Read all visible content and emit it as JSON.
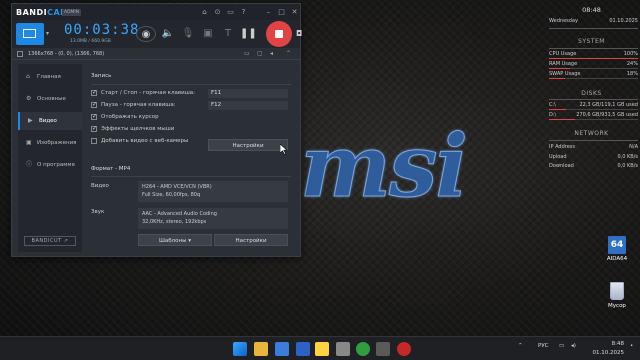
{
  "bandicam": {
    "logo_a": "BANDI",
    "logo_b": "CAM",
    "badge": "ADMIN",
    "timer": "00:03:38",
    "size": "13.0MB / 660.9GB",
    "resolution": "1366x768 - (0, 0), (1366, 768)",
    "sidebar": [
      {
        "label": "Главная",
        "icon": "home-icon"
      },
      {
        "label": "Основные",
        "icon": "gear-icon"
      },
      {
        "label": "Видео",
        "icon": "video-icon"
      },
      {
        "label": "Изображения",
        "icon": "image-icon"
      },
      {
        "label": "О программе",
        "icon": "info-icon"
      }
    ],
    "bandicut": "BANDICUT ↗",
    "record": {
      "title": "Запись",
      "items": [
        {
          "label": "Старт / Стоп - горячая клавиша:",
          "checked": true,
          "hotkey": "F11"
        },
        {
          "label": "Пауза - горячая клавиша:",
          "checked": true,
          "hotkey": "F12"
        },
        {
          "label": "Отображать курсор",
          "checked": true
        },
        {
          "label": "Эффекты щелчков мыши",
          "checked": true
        },
        {
          "label": "Добавить видео с веб-камеры",
          "checked": false
        }
      ],
      "settings_button": "Настройки"
    },
    "format": {
      "title": "Формат - MP4",
      "video_label": "Видео",
      "video_line1": "H264 - AMD VCE/VCN (VBR)",
      "video_line2": "Full Size, 60,00fps, 80q",
      "audio_label": "Звук",
      "audio_line1": "AAC - Advanced Audio Coding",
      "audio_line2": "32,0KHz, stereo, 192kbps",
      "templates_button": "Шаблоны",
      "settings_button": "Настройки"
    }
  },
  "widget": {
    "time": "08:48",
    "day": "Wednesday",
    "date": "01.10.2025",
    "system_title": "SYSTEM",
    "cpu_label": "CPU Usage",
    "cpu_value": "100%",
    "cpu_fill": 1.0,
    "ram_label": "RAM Usage",
    "ram_value": "24%",
    "ram_fill": 0.24,
    "swap_label": "SWAP Usage",
    "swap_value": "18%",
    "swap_fill": 0.18,
    "disks_title": "DISKS",
    "c_label": "C:\\",
    "c_value": "22,3 GB/119,1 GB used",
    "c_fill": 0.19,
    "d_label": "D:\\",
    "d_value": "270,6 GB/931,5 GB used",
    "d_fill": 0.29,
    "network_title": "NETWORK",
    "ip_label": "IP Address",
    "ip_value": "N/A",
    "up_label": "Upload",
    "up_value": "0,0 KB/s",
    "down_label": "Download",
    "down_value": "0,0 KB/s"
  },
  "desktop": {
    "aida_text": "64",
    "aida_label": "AIDA64",
    "bin_label": "Мусор"
  },
  "taskbar": {
    "lang": "РУС",
    "time": "8:48",
    "date": "01.10.2025"
  },
  "colors": {
    "accent": "#1e88e5",
    "record": "#e24343",
    "timer": "#38a8ff",
    "msi_blue": "#2f5c9b"
  }
}
